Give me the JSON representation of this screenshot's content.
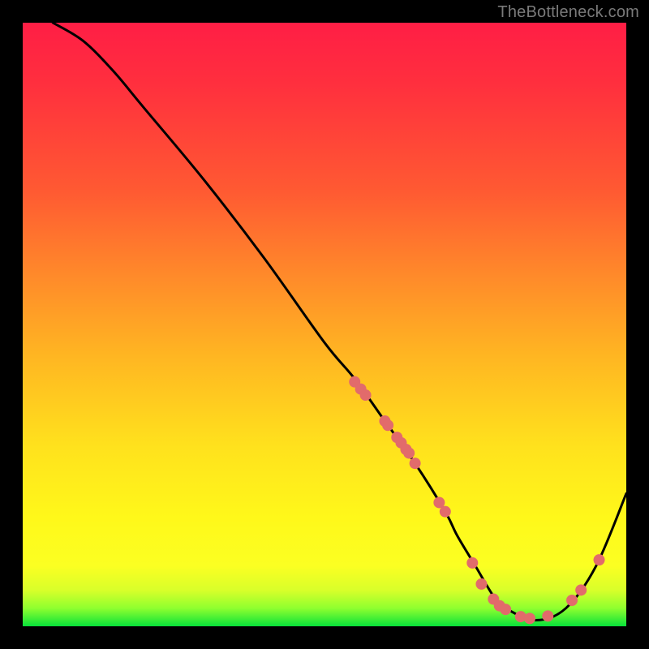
{
  "watermark": "TheBottleneck.com",
  "chart_data": {
    "type": "line",
    "title": "",
    "xlabel": "",
    "ylabel": "",
    "xlim": [
      0,
      100
    ],
    "ylim": [
      0,
      100
    ],
    "grid": false,
    "legend": false,
    "series": [
      {
        "name": "curve",
        "color": "#000000",
        "x": [
          5,
          10,
          15,
          20,
          30,
          40,
          50,
          55,
          60,
          65,
          70,
          72,
          75,
          78,
          80,
          85,
          90,
          95,
          100
        ],
        "y": [
          100,
          97,
          92,
          86,
          74,
          61,
          47,
          41,
          34,
          27,
          19,
          15,
          10,
          5,
          3,
          1,
          3,
          10,
          22
        ]
      }
    ],
    "markers": [
      {
        "name": "dots",
        "color": "#e26b6b",
        "radius": 7,
        "points": [
          {
            "x": 55.0,
            "y": 40.5
          },
          {
            "x": 56.0,
            "y": 39.3
          },
          {
            "x": 56.8,
            "y": 38.3
          },
          {
            "x": 60.0,
            "y": 34.0
          },
          {
            "x": 60.5,
            "y": 33.3
          },
          {
            "x": 62.0,
            "y": 31.3
          },
          {
            "x": 62.7,
            "y": 30.4
          },
          {
            "x": 63.5,
            "y": 29.3
          },
          {
            "x": 64.0,
            "y": 28.7
          },
          {
            "x": 65.0,
            "y": 27.0
          },
          {
            "x": 69.0,
            "y": 20.5
          },
          {
            "x": 70.0,
            "y": 19.0
          },
          {
            "x": 74.5,
            "y": 10.5
          },
          {
            "x": 76.0,
            "y": 7.0
          },
          {
            "x": 78.0,
            "y": 4.5
          },
          {
            "x": 79.0,
            "y": 3.4
          },
          {
            "x": 80.0,
            "y": 2.8
          },
          {
            "x": 82.5,
            "y": 1.6
          },
          {
            "x": 84.0,
            "y": 1.3
          },
          {
            "x": 87.0,
            "y": 1.7
          },
          {
            "x": 91.0,
            "y": 4.3
          },
          {
            "x": 92.5,
            "y": 6.0
          },
          {
            "x": 95.5,
            "y": 11.0
          }
        ]
      }
    ]
  }
}
